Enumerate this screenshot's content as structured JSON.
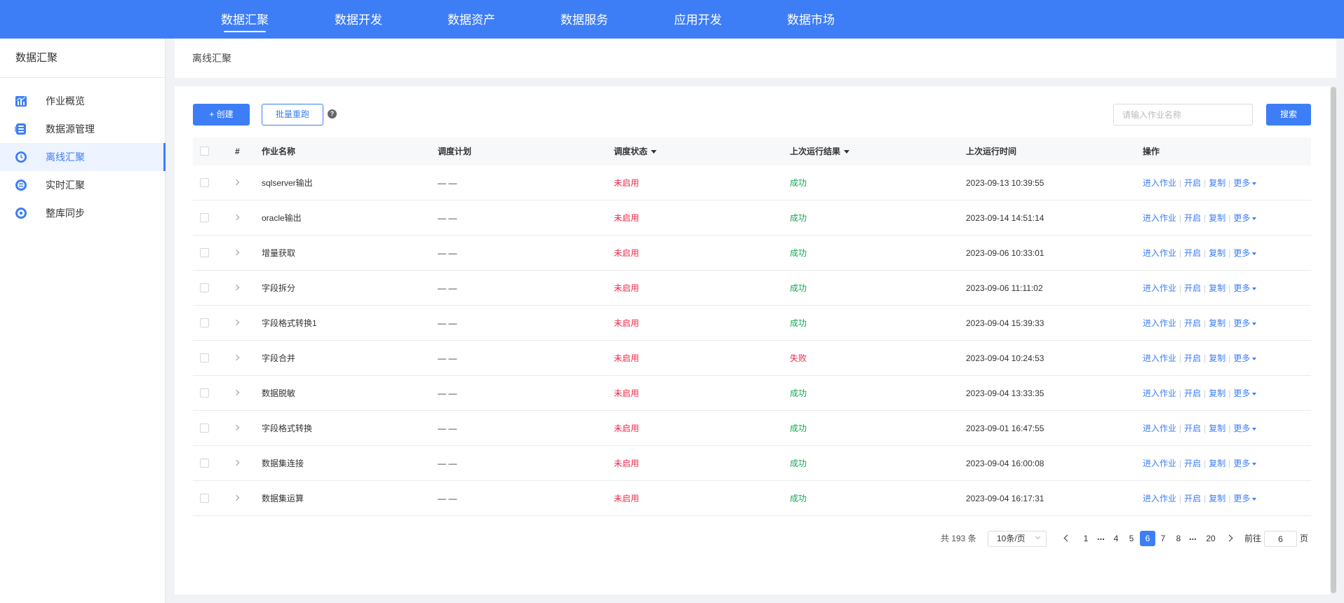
{
  "top_nav": [
    {
      "label": "数据汇聚",
      "active": true
    },
    {
      "label": "数据开发"
    },
    {
      "label": "数据资产"
    },
    {
      "label": "数据服务"
    },
    {
      "label": "应用开发"
    },
    {
      "label": "数据市场"
    }
  ],
  "sidebar": {
    "title": "数据汇聚",
    "items": [
      {
        "label": "作业概览",
        "icon": "chart-icon"
      },
      {
        "label": "数据源管理",
        "icon": "database-icon"
      },
      {
        "label": "离线汇聚",
        "icon": "clock-icon",
        "active": true
      },
      {
        "label": "实时汇聚",
        "icon": "realtime-icon"
      },
      {
        "label": "整库同步",
        "icon": "sync-icon"
      }
    ]
  },
  "breadcrumb": "离线汇聚",
  "toolbar": {
    "create_label": "+ 创建",
    "batch_label": "批量重跑",
    "help": "?",
    "search_placeholder": "请输入作业名称",
    "search_label": "搜索"
  },
  "table": {
    "headers": {
      "index": "#",
      "name": "作业名称",
      "schedule": "调度计划",
      "status": "调度状态",
      "result": "上次运行结果",
      "time": "上次运行时间",
      "ops": "操作"
    },
    "ops_labels": {
      "enter": "进入作业",
      "start": "开启",
      "copy": "复制",
      "more": "更多",
      "sep": "|"
    },
    "rows": [
      {
        "name": "sqlserver输出",
        "schedule": "— —",
        "status": "未启用",
        "result": "成功",
        "time": "2023-09-13 10:39:55"
      },
      {
        "name": "oracle输出",
        "schedule": "— —",
        "status": "未启用",
        "result": "成功",
        "time": "2023-09-14 14:51:14"
      },
      {
        "name": "增量获取",
        "schedule": "— —",
        "status": "未启用",
        "result": "成功",
        "time": "2023-09-06 10:33:01"
      },
      {
        "name": "字段拆分",
        "schedule": "— —",
        "status": "未启用",
        "result": "成功",
        "time": "2023-09-06 11:11:02"
      },
      {
        "name": "字段格式转换1",
        "schedule": "— —",
        "status": "未启用",
        "result": "成功",
        "time": "2023-09-04 15:39:33"
      },
      {
        "name": "字段合并",
        "schedule": "— —",
        "status": "未启用",
        "result": "失败",
        "time": "2023-09-04 10:24:53"
      },
      {
        "name": "数据脱敏",
        "schedule": "— —",
        "status": "未启用",
        "result": "成功",
        "time": "2023-09-04 13:33:35"
      },
      {
        "name": "字段格式转换",
        "schedule": "— —",
        "status": "未启用",
        "result": "成功",
        "time": "2023-09-01 16:47:55"
      },
      {
        "name": "数据集连接",
        "schedule": "— —",
        "status": "未启用",
        "result": "成功",
        "time": "2023-09-04 16:00:08"
      },
      {
        "name": "数据集运算",
        "schedule": "— —",
        "status": "未启用",
        "result": "成功",
        "time": "2023-09-04 16:17:31"
      }
    ]
  },
  "pagination": {
    "total": "共 193 条",
    "page_size": "10条/页",
    "pages": [
      "1",
      "4",
      "5",
      "6",
      "7",
      "8",
      "20"
    ],
    "ellipsis": "...",
    "current": "6",
    "goto_label": "前往",
    "goto_value": "6",
    "page_suffix": "页"
  },
  "colors": {
    "accent": "#3d7ef7",
    "error": "#f0284a",
    "success": "#10a852"
  }
}
